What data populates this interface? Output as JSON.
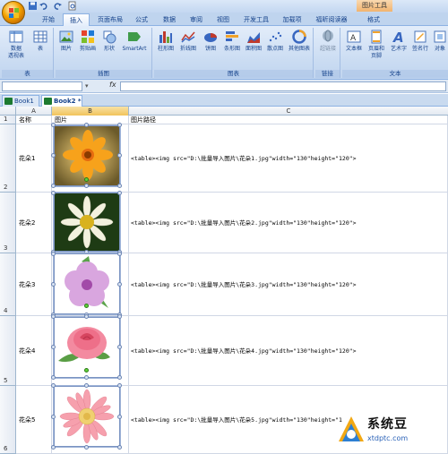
{
  "window": {
    "context_tab_group": "图片工具"
  },
  "ribbon": {
    "tabs": [
      "开始",
      "插入",
      "页面布局",
      "公式",
      "数据",
      "审阅",
      "视图",
      "开发工具",
      "加载项",
      "福昕阅读器",
      "格式"
    ],
    "active_tab": "插入",
    "groups": [
      {
        "label": "表",
        "buttons": [
          "数据\n透视表",
          "表"
        ]
      },
      {
        "label": "插图",
        "buttons": [
          "图片",
          "剪贴画",
          "形状",
          "SmartArt"
        ]
      },
      {
        "label": "图表",
        "buttons": [
          "柱形图",
          "折线图",
          "饼图",
          "条形图",
          "面积图",
          "散点图",
          "其他图表"
        ]
      },
      {
        "label": "链接",
        "buttons": [
          "超链接"
        ]
      },
      {
        "label": "文本",
        "buttons": [
          "文本框",
          "页眉和\n页脚",
          "艺术字",
          "签名行",
          "对象"
        ]
      }
    ]
  },
  "formula_bar": {
    "fx": "fx",
    "name_value": "",
    "formula_value": ""
  },
  "workbooks": [
    {
      "label": "Book1 *",
      "active": false
    },
    {
      "label": "Book2 *",
      "active": true
    }
  ],
  "sheet": {
    "columns": [
      "A",
      "B",
      "C"
    ],
    "rows": [
      {
        "num": "1",
        "name": "名称",
        "pic": "图片",
        "path": "图片路径"
      },
      {
        "num": "2",
        "name": "花朵1",
        "path": "<table><img src=\"D:\\批量导入图片\\花朵1.jpg\"width=\"130\"height=\"120\">"
      },
      {
        "num": "3",
        "name": "花朵2",
        "path": "<table><img src=\"D:\\批量导入图片\\花朵2.jpg\"width=\"130\"height=\"120\">"
      },
      {
        "num": "4",
        "name": "花朵3",
        "path": "<table><img src=\"D:\\批量导入图片\\花朵3.jpg\"width=\"130\"height=\"120\">"
      },
      {
        "num": "5",
        "name": "花朵4",
        "path": "<table><img src=\"D:\\批量导入图片\\花朵4.jpg\"width=\"130\"height=\"120\">"
      },
      {
        "num": "6",
        "name": "花朵5",
        "path": "<table><img src=\"D:\\批量导入图片\\花朵5.jpg\"width=\"130\"height=\"1"
      }
    ]
  },
  "pictures": [
    {
      "subject": "orange-flower",
      "petal": "#f7a21b",
      "center": "#8a3b00",
      "bg": "#6b5a2a"
    },
    {
      "subject": "white-daisy",
      "petal": "#f3f1de",
      "center": "#d8b21e",
      "bg": "#1e3b14"
    },
    {
      "subject": "purple-flower",
      "petal": "#d9a6df",
      "center": "#a24aa8",
      "bg": "#ffffff"
    },
    {
      "subject": "pink-rose",
      "petal": "#f38aa0",
      "center": "#d6455f",
      "bg": "#ffffff"
    },
    {
      "subject": "pink-gerbera",
      "petal": "#f6a0ad",
      "center": "#f0d070",
      "bg": "#ffffff"
    }
  ],
  "watermark": {
    "title": "系统豆",
    "url": "xtdptc.com"
  }
}
